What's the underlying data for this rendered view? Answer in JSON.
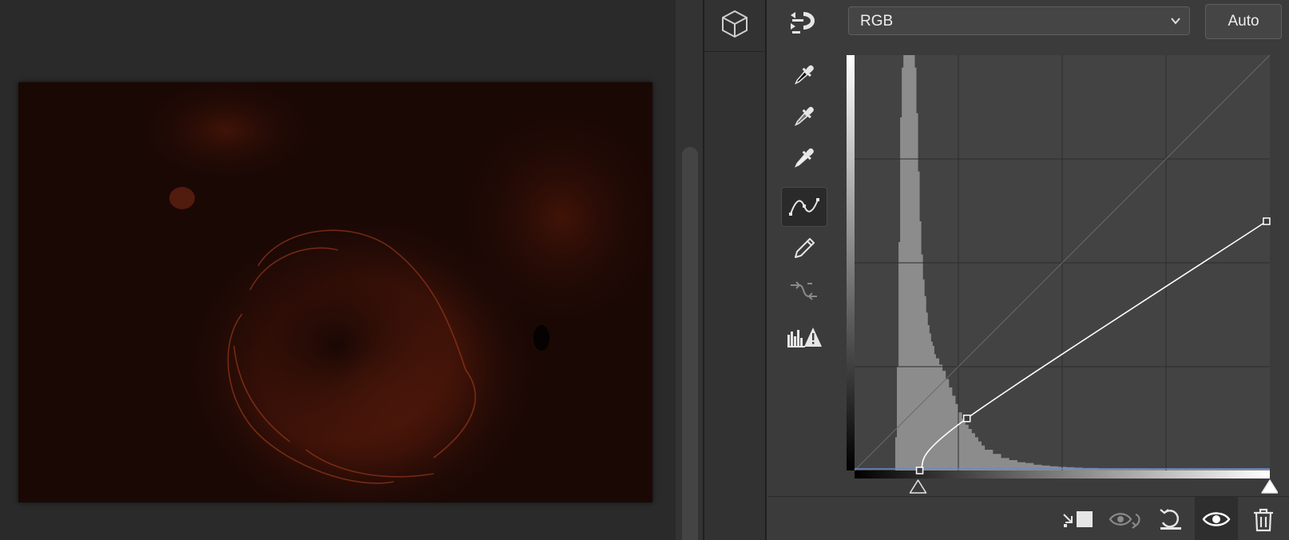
{
  "properties": {
    "channel_select": {
      "value": "RGB"
    },
    "auto_label": "Auto"
  },
  "colors": {
    "canvas_bg": "#2a2a2a",
    "panel_bg": "#3b3b3b",
    "nebula": "#a83a1a",
    "curve": "#ffffff",
    "baseline": "#6a8ad0"
  },
  "tools": [
    "adjust-target-icon",
    "black-point-eyedropper-icon",
    "gray-point-eyedropper-icon",
    "white-point-eyedropper-icon",
    "curve-point-tool-icon",
    "pencil-draw-icon",
    "smooth-curve-icon",
    "clipping-warning-icon"
  ],
  "footer_icons": [
    "clip-to-layer-icon",
    "view-previous-state-icon",
    "reset-icon",
    "visibility-eye-icon",
    "trash-icon"
  ],
  "chart_data": {
    "type": "area",
    "title": "",
    "xlabel": "",
    "ylabel": "",
    "xlim": [
      0,
      255
    ],
    "ylim": [
      0,
      255
    ],
    "grid": true,
    "histogram": {
      "x": [
        24,
        25,
        26,
        27,
        28,
        29,
        30,
        31,
        32,
        33,
        34,
        35,
        36,
        37,
        38,
        39,
        40,
        41,
        42,
        43,
        44,
        45,
        46,
        47,
        48,
        49,
        50,
        52,
        54,
        56,
        58,
        60,
        62,
        64,
        66,
        68,
        70,
        72,
        74,
        76,
        78,
        80,
        85,
        90,
        95,
        100,
        105,
        110,
        115,
        120,
        125,
        130,
        135,
        140,
        150,
        160,
        170,
        180,
        190,
        200,
        210,
        220,
        230,
        240,
        250,
        255
      ],
      "y": [
        0,
        0.08,
        0.25,
        0.55,
        0.85,
        0.97,
        1.0,
        1.0,
        1.0,
        1.0,
        1.0,
        1.0,
        1.0,
        0.97,
        0.86,
        0.72,
        0.6,
        0.52,
        0.46,
        0.42,
        0.38,
        0.35,
        0.33,
        0.31,
        0.3,
        0.28,
        0.27,
        0.255,
        0.24,
        0.22,
        0.2,
        0.18,
        0.16,
        0.14,
        0.125,
        0.11,
        0.1,
        0.09,
        0.08,
        0.07,
        0.06,
        0.05,
        0.04,
        0.03,
        0.025,
        0.02,
        0.018,
        0.014,
        0.012,
        0.01,
        0.009,
        0.008,
        0.007,
        0.006,
        0.005,
        0.005,
        0.005,
        0.004,
        0.004,
        0.004,
        0.003,
        0.003,
        0.003,
        0.003,
        0.003,
        0
      ]
    },
    "curve_points": [
      {
        "input": 40,
        "output": 0
      },
      {
        "input": 69,
        "output": 32
      },
      {
        "input": 253,
        "output": 153
      }
    ],
    "input_black_slider": 39,
    "input_white_slider": 255
  }
}
